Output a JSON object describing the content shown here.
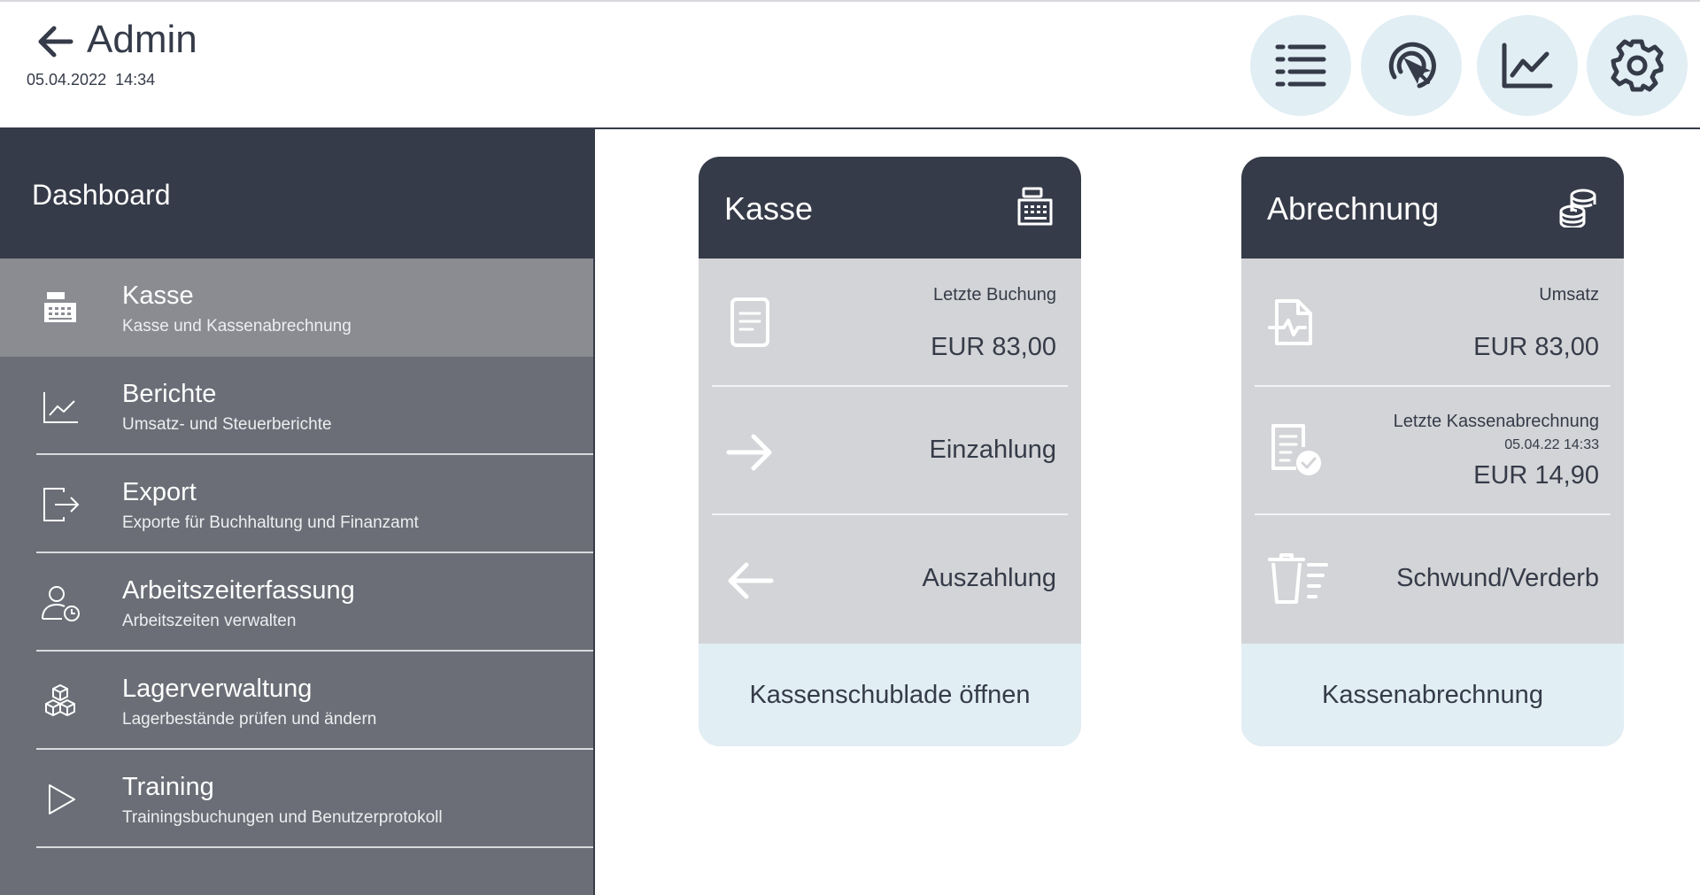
{
  "header": {
    "title": "Admin",
    "datetime": "05.04.2022  14:34",
    "buttons": [
      {
        "icon": "list-icon"
      },
      {
        "icon": "touch-pointer-icon"
      },
      {
        "icon": "chart-line-icon"
      },
      {
        "icon": "gear-icon"
      }
    ]
  },
  "sidebar": {
    "title": "Dashboard",
    "items": [
      {
        "label": "Kasse",
        "sub": "Kasse und Kassenabrechnung",
        "icon": "cash-register-icon",
        "active": true
      },
      {
        "label": "Berichte",
        "sub": "Umsatz- und Steuerberichte",
        "icon": "chart-line-icon"
      },
      {
        "label": "Export",
        "sub": "Exporte für Buchhaltung und Finanzamt",
        "icon": "export-icon"
      },
      {
        "label": "Arbeitszeiterfassung",
        "sub": "Arbeitszeiten verwalten",
        "icon": "user-clock-icon"
      },
      {
        "label": "Lagerverwaltung",
        "sub": "Lagerbestände prüfen und ändern",
        "icon": "boxes-icon"
      },
      {
        "label": "Training",
        "sub": "Trainingsbuchungen und Benutzerprotokoll",
        "icon": "play-icon"
      }
    ]
  },
  "kasse_card": {
    "title": "Kasse",
    "icon": "cash-register-icon",
    "last_booking_label": "Letzte Buchung",
    "last_booking_value": "EUR 83,00",
    "deposit_label": "Einzahlung",
    "withdrawal_label": "Auszahlung",
    "footer": "Kassenschublade öffnen"
  },
  "abrechnung_card": {
    "title": "Abrechnung",
    "icon": "coins-icon",
    "revenue_label": "Umsatz",
    "revenue_value": "EUR 83,00",
    "last_settlement_label": "Letzte Kassenabrechnung",
    "last_settlement_date": "05.04.22 14:33",
    "last_settlement_value": "EUR 14,90",
    "shrinkage_label": "Schwund/Verderb",
    "footer": "Kassenabrechnung"
  },
  "colors": {
    "dark": "#353b48",
    "sidebar": "#6b6e76",
    "sidebar_active": "#8a8c92",
    "card_body": "#d3d4d7",
    "accent_light": "#e1eef4"
  }
}
